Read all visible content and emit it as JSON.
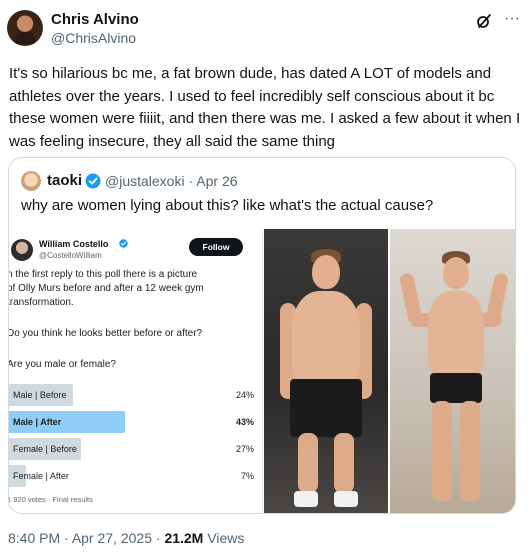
{
  "author": {
    "name": "Chris Alvino",
    "handle": "@ChrisAlvino"
  },
  "tweet": {
    "text": "It's so hilarious bc me, a fat brown dude, has dated A LOT of models and athletes over the years. I used to feel incredibly self conscious about it bc these women were fiiiit, and then there was me. I asked a few about it when I was feeling insecure, they all said the same thing"
  },
  "quoted": {
    "name": "taoki",
    "handle": "@justalexoki",
    "separator": "·",
    "date": "Apr 26",
    "text": "why are women lying about this? like what's the actual cause?"
  },
  "poll_image": {
    "name": "William Costello",
    "handle": "@CostelloWilliam",
    "follow_label": "Follow",
    "lines": [
      "n the first reply to this poll there is a picture",
      "of Olly Murs before and after a 12 week gym",
      "transformation.",
      "Do you think he looks better before or after?",
      "Are you male or female?"
    ],
    "options": [
      {
        "label": "Male | Before",
        "percent": "24%",
        "value": 24,
        "winner": false
      },
      {
        "label": "Male | After",
        "percent": "43%",
        "value": 43,
        "winner": true
      },
      {
        "label": "Female | Before",
        "percent": "27%",
        "value": 27,
        "winner": false
      },
      {
        "label": "Female | After",
        "percent": "7%",
        "value": 7,
        "winner": false
      }
    ],
    "footer": "1 920 votes · Final results"
  },
  "footer": {
    "time": "8:40 PM",
    "sep1": " · ",
    "date": "Apr 27, 2025",
    "sep2": " · ",
    "views": "21.2M",
    "views_label": " Views"
  },
  "icons": {
    "grok": "grok-icon",
    "more": "more-icon",
    "verified": "verified-icon"
  },
  "colors": {
    "accent": "#1d9bf0",
    "poll_winner": "#8ecdf8",
    "poll_bar": "#cfd9de",
    "muted_text": "#536471"
  }
}
